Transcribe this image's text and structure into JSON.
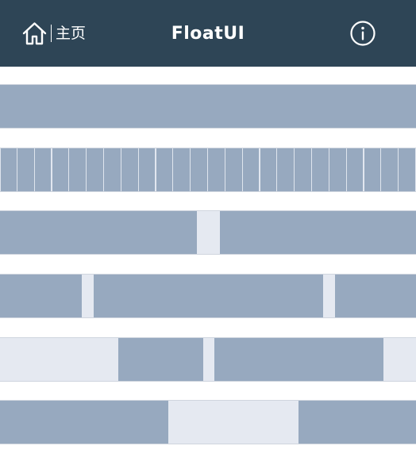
{
  "header": {
    "home_label": "主页",
    "title": "FloatUI",
    "home_icon": "home-icon",
    "info_icon": "info-icon"
  },
  "colors": {
    "header_bg": "#2e4556",
    "block": "#97a9bf",
    "gap": "#e5e9f1"
  }
}
